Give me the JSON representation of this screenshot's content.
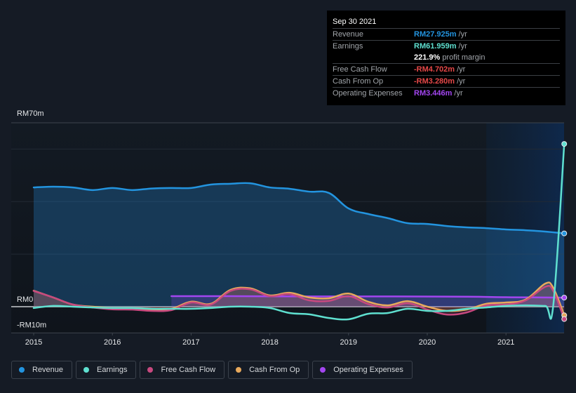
{
  "tooltip": {
    "date": "Sep 30 2021",
    "rows": [
      {
        "label": "Revenue",
        "value": "RM27.925m",
        "unit": "/yr",
        "color": "#2394df"
      },
      {
        "label": "Earnings",
        "value": "RM61.959m",
        "unit": "/yr",
        "color": "#5fe0d0"
      },
      {
        "label": "",
        "value": "221.9%",
        "unit": "profit margin",
        "color": "#ffffff"
      },
      {
        "label": "Free Cash Flow",
        "value": "-RM4.702m",
        "unit": "/yr",
        "color": "#e64848"
      },
      {
        "label": "Cash From Op",
        "value": "-RM3.280m",
        "unit": "/yr",
        "color": "#e64848"
      },
      {
        "label": "Operating Expenses",
        "value": "RM3.446m",
        "unit": "/yr",
        "color": "#a346f0"
      }
    ]
  },
  "legend": [
    {
      "label": "Revenue",
      "color": "#2394df"
    },
    {
      "label": "Earnings",
      "color": "#5fe0d0"
    },
    {
      "label": "Free Cash Flow",
      "color": "#c8497f"
    },
    {
      "label": "Cash From Op",
      "color": "#e8a95c"
    },
    {
      "label": "Operating Expenses",
      "color": "#a346f0"
    }
  ],
  "chart_data": {
    "type": "line",
    "title": "",
    "xlabel": "",
    "ylabel": "",
    "ylim": [
      -10,
      70
    ],
    "xlim": [
      2014.7,
      2021.74
    ],
    "y_tick_labels": [
      {
        "value": 70,
        "label": "RM70m"
      },
      {
        "value": 0,
        "label": "RM0"
      },
      {
        "value": -10,
        "label": "-RM10m"
      }
    ],
    "y_gridlines": [
      70,
      60,
      40,
      20,
      0,
      -10
    ],
    "x_tick_labels": [
      {
        "value": 2015,
        "label": "2015"
      },
      {
        "value": 2016,
        "label": "2016"
      },
      {
        "value": 2017,
        "label": "2017"
      },
      {
        "value": 2018,
        "label": "2018"
      },
      {
        "value": 2019,
        "label": "2019"
      },
      {
        "value": 2020,
        "label": "2020"
      },
      {
        "value": 2021,
        "label": "2021"
      }
    ],
    "highlight_range": [
      2020.75,
      2021.74
    ],
    "grid": true,
    "legend_position": "bottom-left",
    "series": [
      {
        "name": "Revenue",
        "color": "#2394df",
        "fill": true,
        "x": [
          2015.0,
          2015.25,
          2015.5,
          2015.75,
          2016.0,
          2016.25,
          2016.5,
          2016.75,
          2017.0,
          2017.25,
          2017.5,
          2017.75,
          2018.0,
          2018.25,
          2018.5,
          2018.75,
          2019.0,
          2019.25,
          2019.5,
          2019.75,
          2020.0,
          2020.25,
          2020.5,
          2020.75,
          2021.0,
          2021.25,
          2021.5,
          2021.74
        ],
        "values": [
          45.4,
          45.7,
          45.4,
          44.4,
          45.2,
          44.4,
          45.0,
          45.2,
          45.2,
          46.5,
          46.8,
          47.0,
          45.4,
          44.9,
          43.8,
          43.3,
          37.4,
          35.3,
          33.7,
          31.8,
          31.5,
          30.7,
          30.2,
          29.9,
          29.4,
          29.1,
          28.6,
          27.9
        ]
      },
      {
        "name": "Earnings",
        "color": "#5fe0d0",
        "fill": false,
        "x": [
          2015.0,
          2015.25,
          2015.5,
          2015.75,
          2016.0,
          2016.25,
          2016.5,
          2016.75,
          2017.0,
          2017.25,
          2017.5,
          2017.75,
          2018.0,
          2018.25,
          2018.5,
          2018.75,
          2019.0,
          2019.25,
          2019.5,
          2019.75,
          2020.0,
          2020.25,
          2020.5,
          2020.75,
          2021.0,
          2021.25,
          2021.5,
          2021.6,
          2021.74
        ],
        "values": [
          -0.5,
          0.3,
          0.0,
          -0.3,
          -0.5,
          -0.5,
          -0.8,
          -0.8,
          -0.8,
          -0.5,
          0.0,
          0.0,
          -0.5,
          -2.4,
          -2.9,
          -4.3,
          -4.8,
          -2.7,
          -2.4,
          -0.8,
          -1.6,
          -1.6,
          -0.8,
          -0.3,
          0.3,
          0.5,
          0.3,
          0.3,
          61.96
        ]
      },
      {
        "name": "Free Cash Flow",
        "color": "#c8497f",
        "fill": true,
        "x": [
          2015.0,
          2015.25,
          2015.5,
          2015.75,
          2016.0,
          2016.25,
          2016.5,
          2016.75,
          2017.0,
          2017.25,
          2017.5,
          2017.75,
          2018.0,
          2018.25,
          2018.5,
          2018.75,
          2019.0,
          2019.25,
          2019.5,
          2019.75,
          2020.0,
          2020.25,
          2020.5,
          2020.75,
          2021.0,
          2021.25,
          2021.5,
          2021.6,
          2021.74
        ],
        "values": [
          6.0,
          3.5,
          0.8,
          -0.3,
          -1.0,
          -1.1,
          -1.6,
          -1.3,
          1.6,
          0.8,
          6.0,
          6.6,
          4.0,
          4.8,
          2.4,
          2.2,
          4.0,
          1.0,
          -0.3,
          1.3,
          -1.1,
          -3.0,
          -2.2,
          0.5,
          0.8,
          2.4,
          7.6,
          6.0,
          -4.7
        ]
      },
      {
        "name": "Cash From Op",
        "color": "#e8a95c",
        "fill": true,
        "x": [
          2015.0,
          2015.25,
          2015.5,
          2015.75,
          2016.0,
          2016.25,
          2016.5,
          2016.75,
          2017.0,
          2017.25,
          2017.5,
          2017.75,
          2018.0,
          2018.25,
          2018.5,
          2018.75,
          2019.0,
          2019.25,
          2019.5,
          2019.75,
          2020.0,
          2020.25,
          2020.5,
          2020.75,
          2021.0,
          2021.25,
          2021.5,
          2021.6,
          2021.74
        ],
        "values": [
          6.1,
          3.5,
          0.8,
          0.0,
          -0.5,
          -0.6,
          -1.1,
          -0.8,
          1.9,
          1.1,
          6.4,
          7.0,
          4.3,
          5.3,
          3.5,
          3.2,
          5.0,
          1.9,
          0.5,
          2.1,
          0.0,
          -1.6,
          -1.1,
          1.1,
          1.6,
          2.7,
          8.8,
          7.2,
          -3.28
        ]
      },
      {
        "name": "Operating Expenses",
        "color": "#a346f0",
        "fill": true,
        "x": [
          2016.75,
          2017.5,
          2018.5,
          2019.5,
          2020.5,
          2021.0,
          2021.5,
          2021.74
        ],
        "values": [
          4.0,
          4.0,
          3.9,
          3.9,
          3.8,
          3.6,
          3.5,
          3.45
        ]
      }
    ]
  }
}
